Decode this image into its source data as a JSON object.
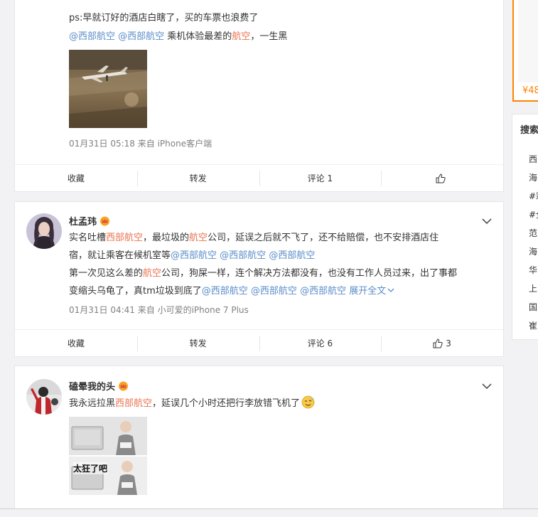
{
  "post1": {
    "line1": "ps:早就订好的酒店白瞎了，买的车票也浪费了",
    "mention_a": "@西部航空",
    "mention_b": "@西部航空",
    "line2_a": " 乘机体验最差的",
    "line2_hl": "航空",
    "line2_b": "，一生黑",
    "timestamp": "01月31日 05:18 来自 iPhone客户端",
    "actions": {
      "favorite": "收藏",
      "forward": "转发",
      "comment": "评论 1",
      "like": ""
    }
  },
  "post2": {
    "username": "杜孟玮",
    "l1_a": "实名吐槽",
    "l1_hl1": "西部航空",
    "l1_b": "，最垃圾的",
    "l1_hl2": "航空",
    "l1_c": "公司，延误之后就不飞了，还不给赔偿，也不安排酒店住",
    "l2_a": "宿，就让乘客在候机室等",
    "m1": "@西部航空",
    "m2": "@西部航空",
    "m3": "@西部航空",
    "l3_a": "第一次见这么差的",
    "l3_hl": "航空",
    "l3_b": "公司，狗屎一样，连个解决方法都没有，也没有工作人员过来，出了事都",
    "l4_a": "变缩头乌龟了，真tm垃圾到底了",
    "m4": "@西部航空",
    "m5": "@西部航空",
    "m6": "@西部航空",
    "expand": "展开全文",
    "timestamp": "01月31日 04:41 来自 小可爱的iPhone 7 Plus",
    "actions": {
      "favorite": "收藏",
      "forward": "转发",
      "comment": "评论 6",
      "like": "3"
    }
  },
  "post3": {
    "username": "磕晕我的头",
    "l1_a": "我永远拉黑",
    "l1_hl": "西部航空",
    "l1_b": "，延误几个小时还把行李放错飞机了",
    "meme_caption": "太狂了吧"
  },
  "sidebar": {
    "price": "¥48",
    "search_title": "搜索",
    "search_items": [
      "西",
      "海",
      "#彩",
      "#全",
      "范",
      "海",
      "华",
      "上",
      "国",
      "崔"
    ]
  },
  "colors": {
    "highlight": "#eb7350",
    "mention": "#5b8dc9",
    "accent": "#ff8200"
  }
}
